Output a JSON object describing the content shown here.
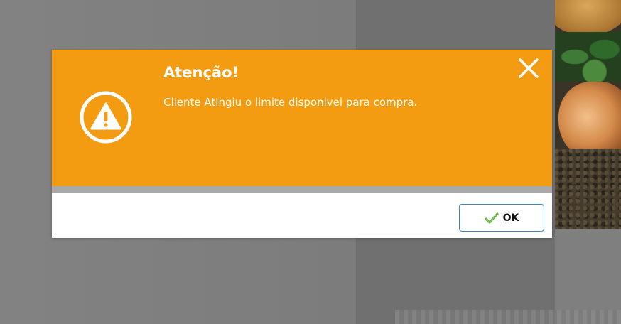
{
  "dialog": {
    "title": "Atenção!",
    "message": "Cliente Atingiu o limite disponivel para compra.",
    "ok_button": {
      "mnemonic": "O",
      "rest": "K"
    },
    "icons": {
      "alert": "warning-triangle-icon",
      "close": "close-icon",
      "ok": "checkmark-icon"
    }
  },
  "colors": {
    "header": "#f39c12",
    "separator": "#a9a9a9",
    "ok_border": "#3a84c3",
    "check": "#5aa832"
  }
}
